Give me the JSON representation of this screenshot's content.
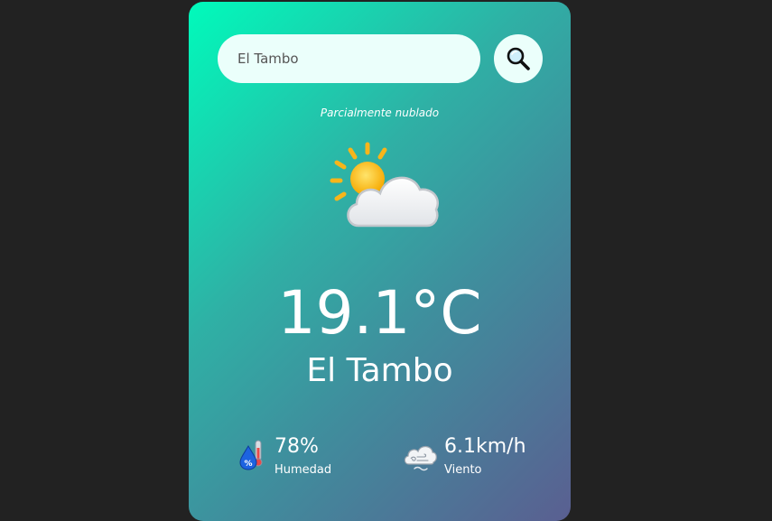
{
  "search": {
    "value": "El Tambo",
    "icon": "search-icon"
  },
  "weather": {
    "condition": "Parcialmente nublado",
    "icon": "partly-cloudy-icon",
    "temperature": "19.1°C",
    "city": "El Tambo"
  },
  "stats": {
    "humidity": {
      "value": "78%",
      "label": "Humedad",
      "icon": "humidity-icon"
    },
    "wind": {
      "value": "6.1km/h",
      "label": "Viento",
      "icon": "wind-icon"
    }
  },
  "colors": {
    "page_background": "#222222",
    "gradient_start": "#00fbbb",
    "gradient_end": "#5a5f91",
    "input_background": "#ebfffb"
  }
}
